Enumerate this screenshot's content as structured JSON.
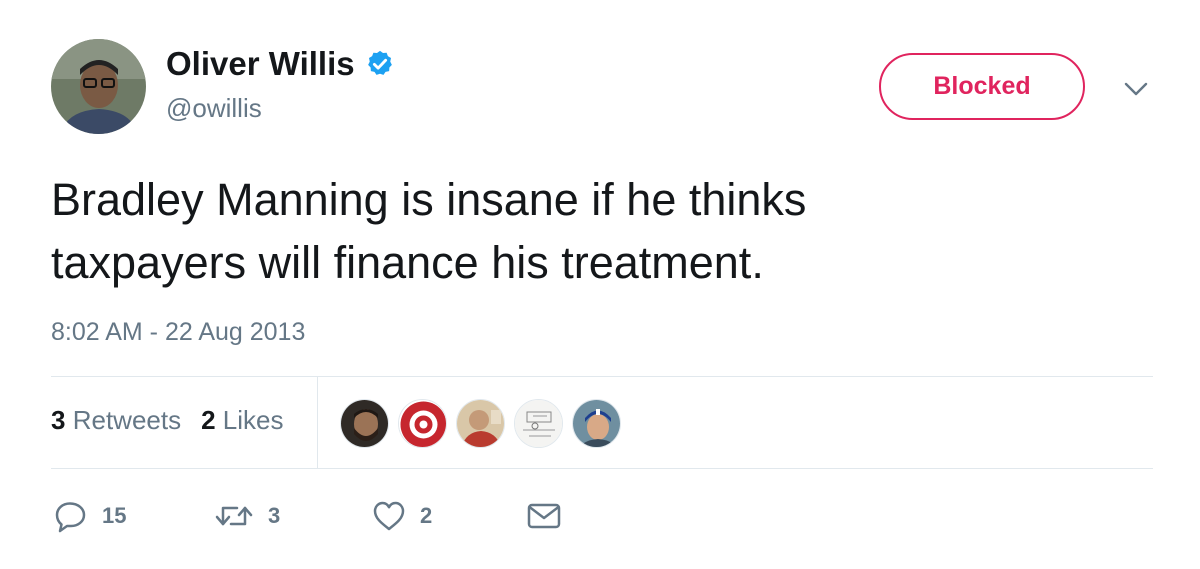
{
  "user": {
    "display_name": "Oliver Willis",
    "handle": "@owillis",
    "verified": true
  },
  "follow_state": {
    "label": "Blocked",
    "color": "#e0245e"
  },
  "tweet": {
    "text_lines": [
      "Bradley Manning is insane if he thinks",
      "taxpayers will finance his treatment."
    ],
    "timestamp": "8:02 AM - 22 Aug 2013"
  },
  "stats": {
    "retweets_count": "3",
    "retweets_label": "Retweets",
    "likes_count": "2",
    "likes_label": "Likes"
  },
  "liker_avatars": [
    "bearded-man",
    "circular-red-logo",
    "man-in-red",
    "sketch-diagram",
    "man-in-cap"
  ],
  "actions": {
    "reply_count": "15",
    "retweet_count": "3",
    "like_count": "2"
  },
  "icons": [
    "verified-badge-icon",
    "chevron-down-icon",
    "reply-icon",
    "retweet-icon",
    "heart-icon",
    "envelope-icon"
  ],
  "colors": {
    "text": "#14171a",
    "secondary": "#657786",
    "divider": "#e1e8ed",
    "verified": "#1da1f2",
    "blocked": "#e0245e"
  }
}
